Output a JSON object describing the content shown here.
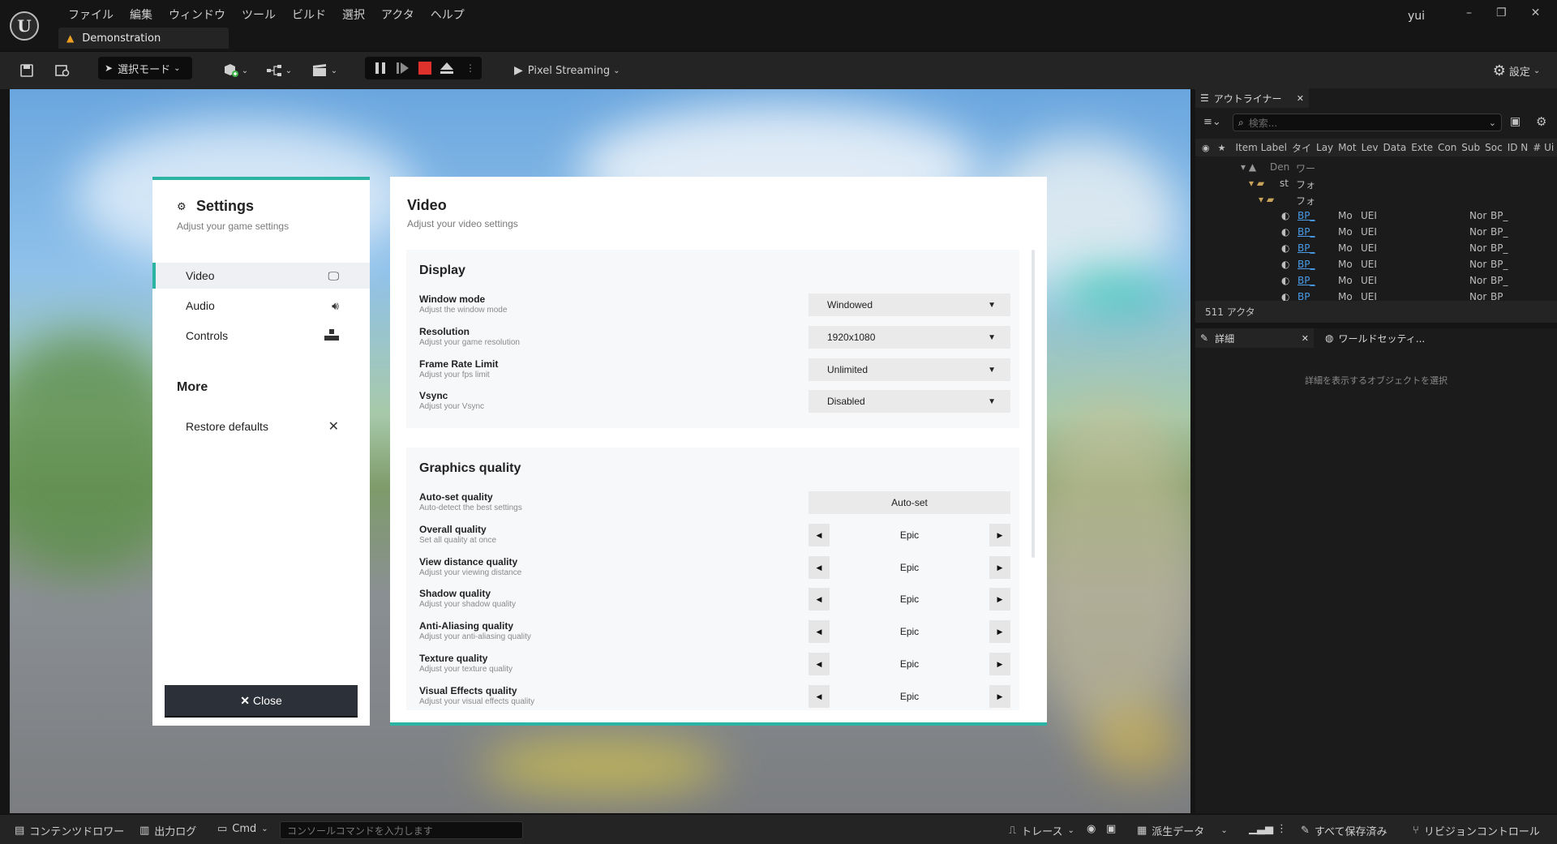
{
  "window": {
    "menu": [
      "ファイル",
      "編集",
      "ウィンドウ",
      "ツール",
      "ビルド",
      "選択",
      "アクタ",
      "ヘルプ"
    ],
    "tab_title": "Demonstration",
    "user": "yui",
    "controls": [
      "–",
      "❐",
      "✕"
    ]
  },
  "toolbar": {
    "mode_label": "選択モード",
    "pixel_streaming": "Pixel Streaming",
    "settings_label": "設定"
  },
  "settings": {
    "title": "Settings",
    "subtitle": "Adjust your game settings",
    "nav": [
      {
        "label": "Video",
        "icon": "monitor-icon"
      },
      {
        "label": "Audio",
        "icon": "speaker-icon"
      },
      {
        "label": "Controls",
        "icon": "controls-icon"
      }
    ],
    "more_title": "More",
    "restore_label": "Restore defaults",
    "close_label": "Close",
    "accent_color": "#2bb3a3"
  },
  "video": {
    "title": "Video",
    "subtitle": "Adjust your video settings",
    "display": {
      "title": "Display",
      "rows": [
        {
          "label": "Window mode",
          "desc": "Adjust the window mode",
          "value": "Windowed"
        },
        {
          "label": "Resolution",
          "desc": "Adjust your game resolution",
          "value": "1920x1080"
        },
        {
          "label": "Frame Rate Limit",
          "desc": "Adjust your fps limit",
          "value": "Unlimited"
        },
        {
          "label": "Vsync",
          "desc": "Adjust your Vsync",
          "value": "Disabled"
        }
      ]
    },
    "graphics": {
      "title": "Graphics quality",
      "auto": {
        "label": "Auto-set quality",
        "desc": "Auto-detect the best settings",
        "button": "Auto-set"
      },
      "rows": [
        {
          "label": "Overall quality",
          "desc": "Set all quality at once",
          "value": "Epic"
        },
        {
          "label": "View distance quality",
          "desc": "Adjust your viewing distance",
          "value": "Epic"
        },
        {
          "label": "Shadow quality",
          "desc": "Adjust your shadow quality",
          "value": "Epic"
        },
        {
          "label": "Anti-Aliasing quality",
          "desc": "Adjust your anti-aliasing quality",
          "value": "Epic"
        },
        {
          "label": "Texture quality",
          "desc": "Adjust your texture quality",
          "value": "Epic"
        },
        {
          "label": "Visual Effects quality",
          "desc": "Adjust your visual effects quality",
          "value": "Epic"
        }
      ]
    }
  },
  "outliner": {
    "tab": "アウトライナー",
    "search_placeholder": "検索...",
    "columns": [
      "Item Label",
      "タイ",
      "Lay",
      "Mot",
      "Lev",
      "Data",
      "Exte",
      "Con",
      "Sub",
      "Soc",
      "ID N",
      "# Ui"
    ],
    "tree": [
      {
        "name": "Den",
        "type": "ワー"
      },
      {
        "name": "st",
        "type": "フォ"
      },
      {
        "name": "",
        "type": "フォ"
      }
    ],
    "rows": [
      {
        "label": "BP_",
        "c2": "Mo",
        "c3": "UEI",
        "c4": "Nor",
        "c5": "BP_"
      },
      {
        "label": "BP_",
        "c2": "Mo",
        "c3": "UEI",
        "c4": "Nor",
        "c5": "BP_"
      },
      {
        "label": "BP_",
        "c2": "Mo",
        "c3": "UEI",
        "c4": "Nor",
        "c5": "BP_"
      },
      {
        "label": "BP_",
        "c2": "Mo",
        "c3": "UEI",
        "c4": "Nor",
        "c5": "BP_"
      },
      {
        "label": "BP_",
        "c2": "Mo",
        "c3": "UEI",
        "c4": "Nor",
        "c5": "BP_"
      },
      {
        "label": "BP_",
        "c2": "Mo",
        "c3": "UEI",
        "c4": "Nor",
        "c5": "BP_"
      }
    ],
    "actor_count": "511 アクタ"
  },
  "details": {
    "tab": "詳細",
    "world_tab": "ワールドセッティ...",
    "empty_message": "詳細を表示するオブジェクトを選択"
  },
  "statusbar": {
    "content_drawer": "コンテンツドロワー",
    "output_log": "出力ログ",
    "cmd": "Cmd",
    "console_placeholder": "コンソールコマンドを入力します",
    "trace": "トレース",
    "derived_data": "派生データ",
    "save_all": "すべて保存済み",
    "revision_control": "リビジョンコントロール"
  }
}
